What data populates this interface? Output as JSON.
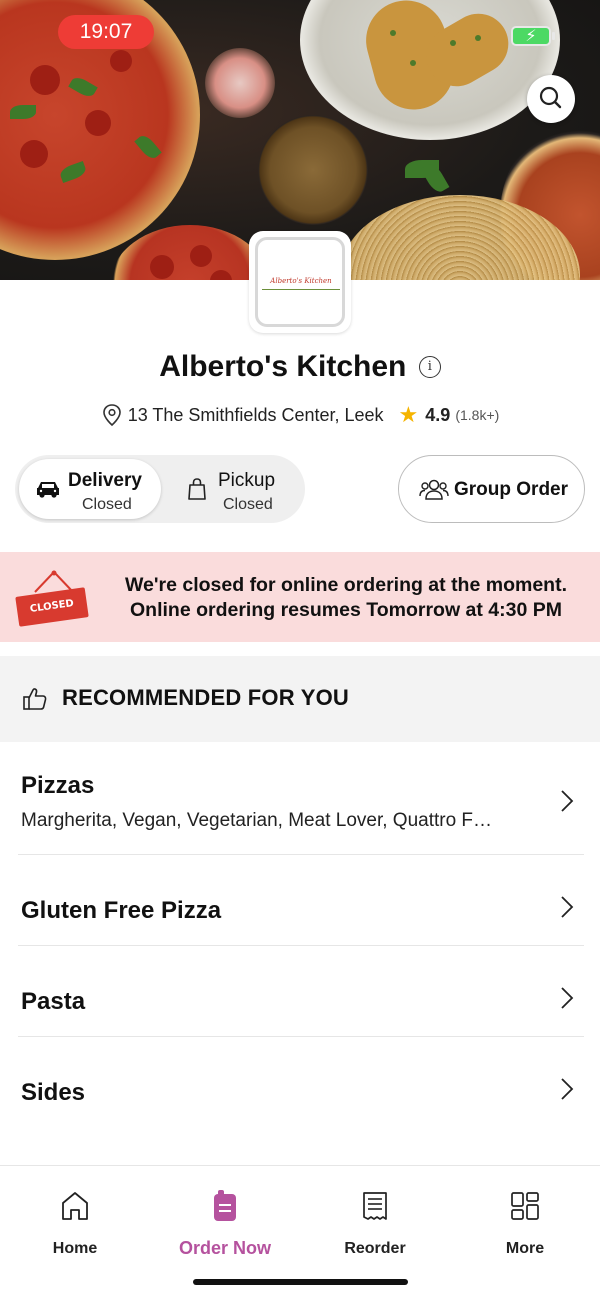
{
  "status_bar": {
    "time": "19:07"
  },
  "restaurant": {
    "name": "Alberto's Kitchen",
    "logo_text": "Alberto's Kitchen",
    "address": "13 The Smithfields Center, Leek",
    "rating": "4.9",
    "rating_count": "(1.8k+)"
  },
  "order_mode": {
    "delivery": {
      "label": "Delivery",
      "status": "Closed",
      "selected": true
    },
    "pickup": {
      "label": "Pickup",
      "status": "Closed",
      "selected": false
    }
  },
  "group_order": {
    "label": "Group Order"
  },
  "closed_banner": {
    "badge": "CLOSED",
    "line1": "We're closed for online ordering at the moment.",
    "line2": "Online ordering resumes Tomorrow at 4:30 PM"
  },
  "recommended": {
    "label": "RECOMMENDED FOR YOU"
  },
  "menu": [
    {
      "title": "Pizzas",
      "description": "Margherita, Vegan, Vegetarian, Meat Lover, Quattro F…"
    },
    {
      "title": "Gluten Free Pizza"
    },
    {
      "title": "Pasta"
    },
    {
      "title": "Sides"
    }
  ],
  "tabbar": {
    "active": "order_now",
    "accent_color": "#b5529e",
    "tabs": [
      {
        "id": "home",
        "label": "Home",
        "icon": "home-icon"
      },
      {
        "id": "order_now",
        "label": "Order Now",
        "icon": "order-icon"
      },
      {
        "id": "reorder",
        "label": "Reorder",
        "icon": "receipt-icon"
      },
      {
        "id": "more",
        "label": "More",
        "icon": "grid-icon"
      }
    ]
  },
  "colors": {
    "closed_banner_bg": "#fadcdc",
    "closed_badge": "#d83a2f",
    "star": "#f5b400",
    "status_time_pill": "#ee3c36"
  }
}
